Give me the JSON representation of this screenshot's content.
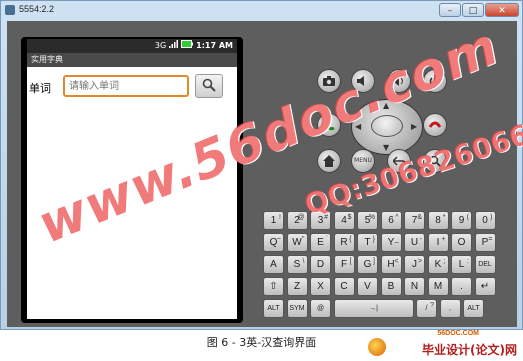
{
  "window": {
    "title": "5554:2.2",
    "buttons": {
      "minimize": "–",
      "maximize": "□",
      "close": "✕"
    }
  },
  "phone": {
    "status": {
      "network": "3G",
      "signal_icon": "signal-icon",
      "battery_icon": "battery-icon",
      "time": "1:17 AM"
    },
    "app_title": "实用字典",
    "search": {
      "label": "单词",
      "placeholder": "请输入单词",
      "button_icon": "magnifier-icon"
    }
  },
  "controls": {
    "camera_icon": "camera-icon",
    "volume_down_icon": "volume-down-icon",
    "volume_up_icon": "volume-up-icon",
    "power_icon": "power-icon",
    "call_icon": "call-icon",
    "end_call_icon": "end-call-icon",
    "home_icon": "home-icon",
    "menu_label": "MENU",
    "back_icon": "back-icon",
    "search_icon": "search-icon"
  },
  "keyboard": {
    "row1": [
      {
        "k": "1",
        "s": "!"
      },
      {
        "k": "2",
        "s": "@"
      },
      {
        "k": "3",
        "s": "#"
      },
      {
        "k": "4",
        "s": "$"
      },
      {
        "k": "5",
        "s": "%"
      },
      {
        "k": "6",
        "s": "^"
      },
      {
        "k": "7",
        "s": "&"
      },
      {
        "k": "8",
        "s": "*"
      },
      {
        "k": "9",
        "s": "("
      },
      {
        "k": "0",
        "s": ")"
      }
    ],
    "row2": [
      {
        "k": "Q",
        "s": "~"
      },
      {
        "k": "W",
        "s": "\""
      },
      {
        "k": "E",
        "s": "`"
      },
      {
        "k": "R",
        "s": "{"
      },
      {
        "k": "T",
        "s": "}"
      },
      {
        "k": "Y",
        "s": "_"
      },
      {
        "k": "U",
        "s": "-"
      },
      {
        "k": "I",
        "s": "+"
      },
      {
        "k": "O",
        "s": ""
      },
      {
        "k": "P",
        "s": "="
      }
    ],
    "row3": [
      {
        "k": "A",
        "s": ""
      },
      {
        "k": "S",
        "s": "\\"
      },
      {
        "k": "D",
        "s": ""
      },
      {
        "k": "F",
        "s": "["
      },
      {
        "k": "G",
        "s": "]"
      },
      {
        "k": "H",
        "s": "<"
      },
      {
        "k": "J",
        "s": ">"
      },
      {
        "k": "K",
        "s": ";"
      },
      {
        "k": "L",
        "s": ":"
      },
      {
        "k": "DEL",
        "s": ""
      }
    ],
    "row4": [
      {
        "k": "⇧",
        "s": ""
      },
      {
        "k": "Z",
        "s": ""
      },
      {
        "k": "X",
        "s": ""
      },
      {
        "k": "C",
        "s": ""
      },
      {
        "k": "V",
        "s": ""
      },
      {
        "k": "B",
        "s": ""
      },
      {
        "k": "N",
        "s": ""
      },
      {
        "k": "M",
        "s": ""
      },
      {
        "k": ".",
        "s": ""
      },
      {
        "k": "↵",
        "s": ""
      }
    ],
    "row5": [
      {
        "k": "ALT",
        "s": ""
      },
      {
        "k": "SYM",
        "s": ""
      },
      {
        "k": "@",
        "s": ""
      },
      {
        "k": "→|",
        "s": ""
      },
      {
        "k": "/",
        "s": "?"
      },
      {
        "k": ",",
        "s": ""
      },
      {
        "k": "ALT",
        "s": ""
      }
    ]
  },
  "watermarks": {
    "site": "www.56doc.com",
    "qq": "QQ:306826066"
  },
  "caption": "图 6 - 3英-汉查询界面",
  "footer": {
    "site_url": "56DOC.COM",
    "site_name": "毕业设计(论文)网"
  },
  "colors": {
    "accent_orange": "#e08a2a",
    "watermark_red": "#eb4646",
    "emulator_gray": "#5e5e5e"
  }
}
